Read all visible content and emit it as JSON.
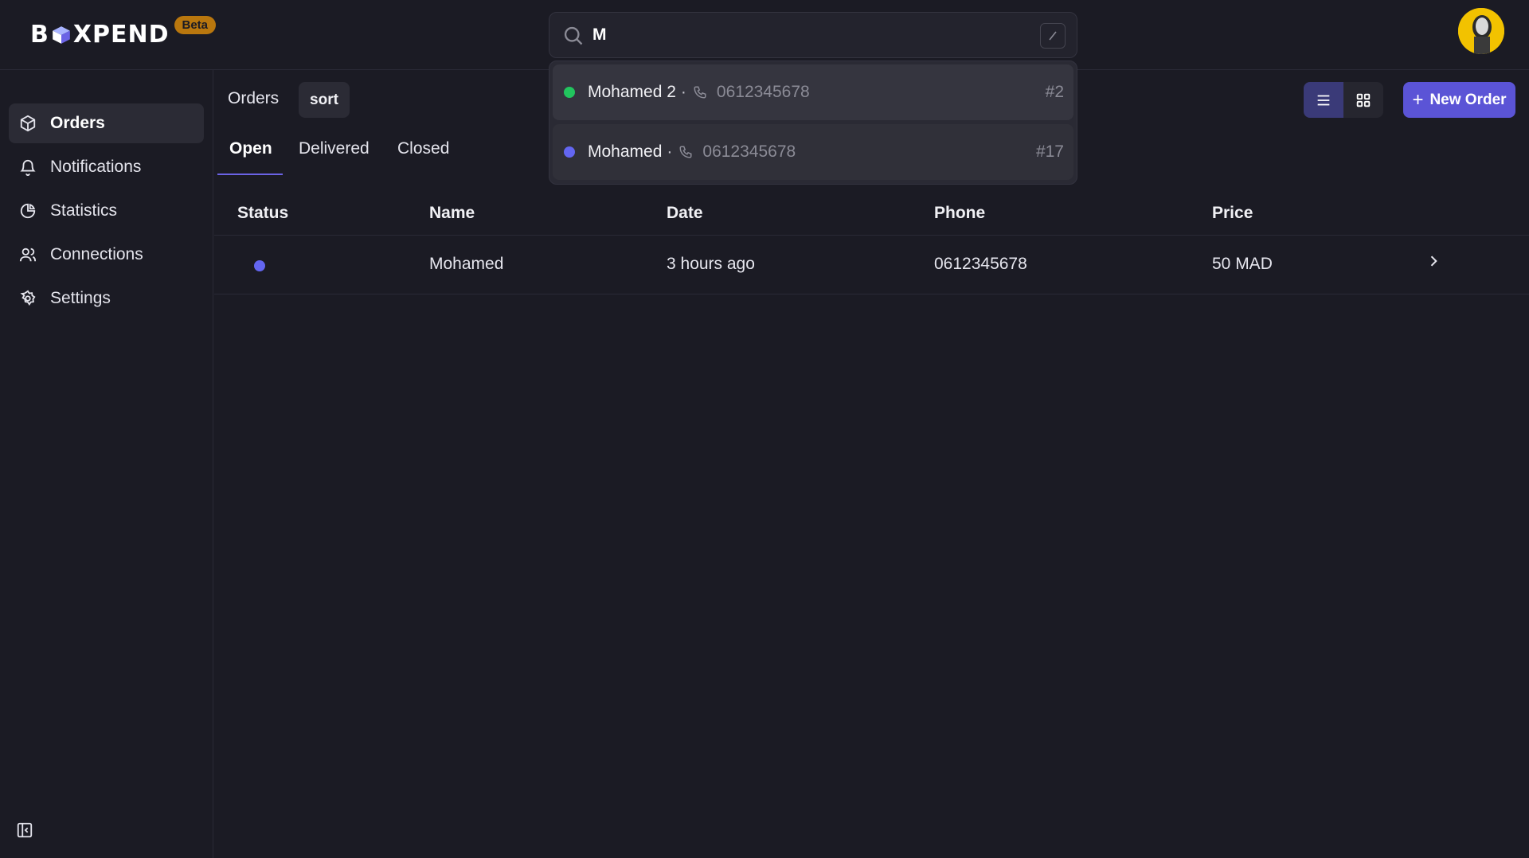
{
  "brand": {
    "logo_prefix": "B",
    "logo_suffix": "XPEND",
    "badge": "Beta",
    "badge_color": "#b9770e"
  },
  "search": {
    "value": "M",
    "placeholder": "",
    "results": [
      {
        "name": "Mohamed 2",
        "separator": "·",
        "phone": "0612345678",
        "number": "#2",
        "status_color": "#22c55e"
      },
      {
        "name": "Mohamed",
        "separator": "·",
        "phone": "0612345678",
        "number": "#17",
        "status_color": "#6366f1"
      }
    ]
  },
  "sidebar": {
    "items": [
      {
        "label": "Orders",
        "icon": "package-icon",
        "active": true
      },
      {
        "label": "Notifications",
        "icon": "bell-icon",
        "active": false
      },
      {
        "label": "Statistics",
        "icon": "pie-chart-icon",
        "active": false
      },
      {
        "label": "Connections",
        "icon": "users-icon",
        "active": false
      },
      {
        "label": "Settings",
        "icon": "gear-icon",
        "active": false
      }
    ]
  },
  "main": {
    "breadcrumb": "Orders",
    "sort_label": "sort",
    "tabs": [
      {
        "label": "Open",
        "active": true
      },
      {
        "label": "Delivered",
        "active": false
      },
      {
        "label": "Closed",
        "active": false
      }
    ],
    "new_order_label": "New Order",
    "accent_color": "#5b54d6"
  },
  "table": {
    "columns": [
      "Status",
      "Name",
      "Date",
      "Phone",
      "Price"
    ],
    "rows": [
      {
        "status_color": "#6366f1",
        "name": "Mohamed",
        "date": "3 hours ago",
        "phone": "0612345678",
        "price": "50 MAD"
      }
    ]
  }
}
